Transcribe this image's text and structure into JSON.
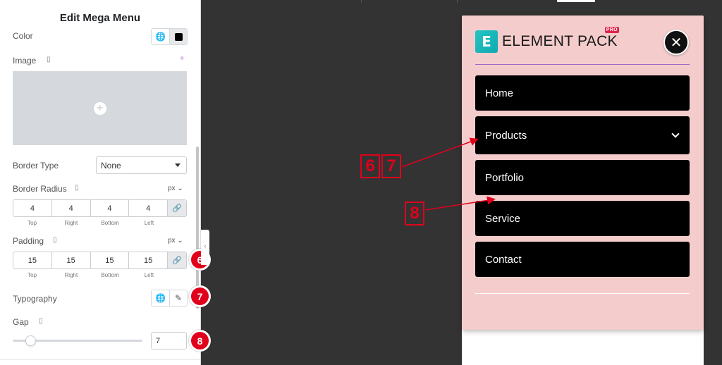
{
  "panel": {
    "title": "Edit Mega Menu",
    "color_label": "Color",
    "image_label": "Image",
    "image_add_symbol": "+",
    "border_type_label": "Border Type",
    "border_type_value": "None",
    "border_radius_label": "Border Radius",
    "border_radius_unit": "px",
    "border_radius_values": [
      "4",
      "4",
      "4",
      "4"
    ],
    "side_labels": [
      "Top",
      "Right",
      "Bottom",
      "Left"
    ],
    "padding_label": "Padding",
    "padding_unit": "px",
    "padding_values": [
      "15",
      "15",
      "15",
      "15"
    ],
    "typography_label": "Typography",
    "gap_label": "Gap",
    "gap_value": "7",
    "gap_slider_fraction": 0.14
  },
  "markers": [
    "6",
    "7",
    "8"
  ],
  "preview": {
    "logo_letter": "E",
    "logo_text": "ELEMENT PACK",
    "logo_badge": "PRO",
    "close_symbol": "✕",
    "menu_items": [
      "Home",
      "Products",
      "Portfolio",
      "Service",
      "Contact"
    ],
    "card_bg": "#f5cccc"
  },
  "annotations": [
    "6",
    "7",
    "8"
  ],
  "colors": {
    "accent_red": "#e0001b",
    "canvas_bg": "#333333",
    "menu_item_bg": "#000000"
  }
}
